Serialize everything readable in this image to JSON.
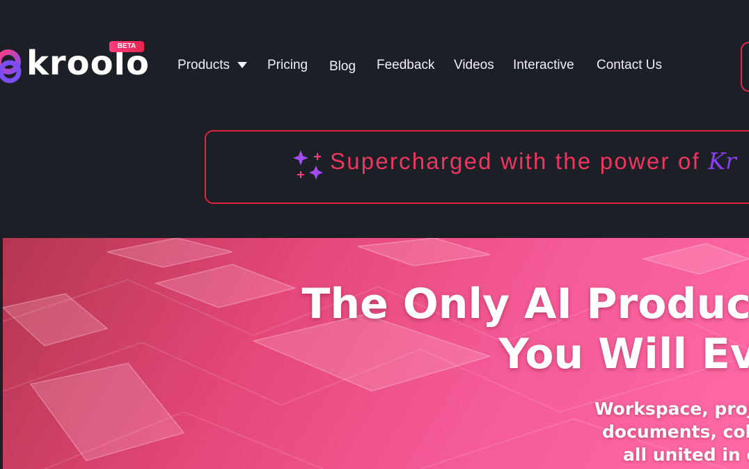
{
  "header": {
    "logo_text": "kroolo",
    "beta_badge": "BETA",
    "nav": [
      {
        "label": "Products",
        "has_dropdown": true
      },
      {
        "label": "Pricing"
      },
      {
        "label": "Blog"
      },
      {
        "label": "Feedback"
      },
      {
        "label": "Videos"
      },
      {
        "label": "Interactive"
      },
      {
        "label": "Contact Us"
      }
    ]
  },
  "banner": {
    "text": "Supercharged with the power of ",
    "brand": "Kr",
    "icon": "sparkles-icon"
  },
  "hero": {
    "title_line1": "The Only AI Productivity  M",
    "title_line2": "You Will Ev",
    "subtitle_line1": "Workspace, proje",
    "subtitle_line2": "documents, coll",
    "subtitle_line3": "all united in o"
  },
  "colors": {
    "background": "#1c1f26",
    "accent_red": "#e8244f",
    "brand_purple": "#8b3df0",
    "hero_pink": "#f45a96"
  }
}
